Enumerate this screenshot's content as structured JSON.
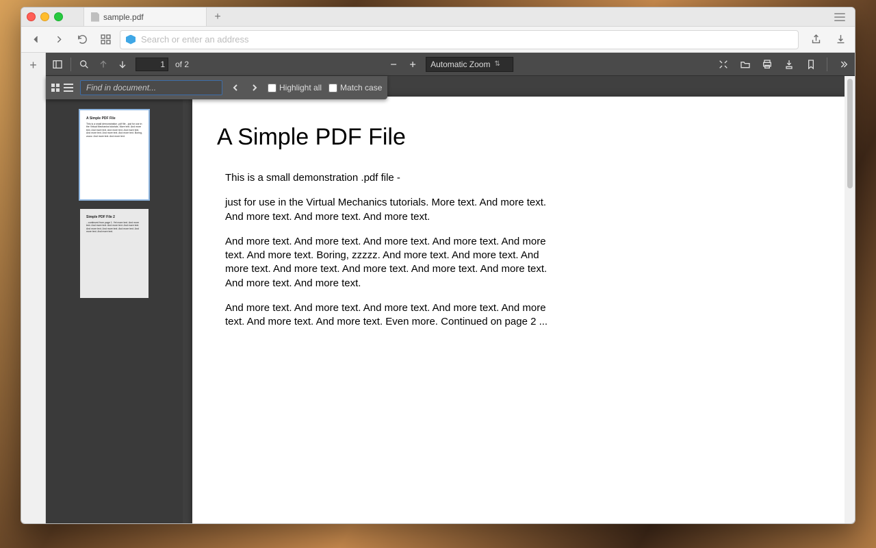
{
  "browser": {
    "tab_title": "sample.pdf",
    "address_placeholder": "Search or enter an address"
  },
  "pdf_toolbar": {
    "current_page": "1",
    "page_count_label": "of 2",
    "zoom_label": "Automatic Zoom"
  },
  "findbar": {
    "placeholder": "Find in document...",
    "highlight_label": "Highlight all",
    "matchcase_label": "Match case"
  },
  "thumbs": {
    "t1_title": "A Simple PDF File",
    "t1_body": "This is a small demonstration .pdf file - just for use in the Virtual Mechanics tutorials. More text. And more text. And more text. And more text. And more text. And more text. And more text. And more text. Boring, zzzzz. And more text. And more text.",
    "t2_title": "Simple PDF File 2",
    "t2_body": "...continued from page 1. Yet more text. And more text. And more text. And more text. And more text. And more text. And more text. And more text. And more text. And more text."
  },
  "page": {
    "title": "A Simple PDF File",
    "p1": "This is a small demonstration .pdf file -",
    "p2": "just for use in the Virtual Mechanics tutorials. More text. And more text. And more text. And more text. And more text.",
    "p3": "And more text. And more text. And more text. And more text. And more text. And more text. Boring, zzzzz. And more text. And more text. And more text. And more text. And more text. And more text. And more text. And more text. And more text.",
    "p4": "And more text. And more text. And more text. And more text. And more text. And more text. And more text. Even more. Continued on page 2 ..."
  }
}
